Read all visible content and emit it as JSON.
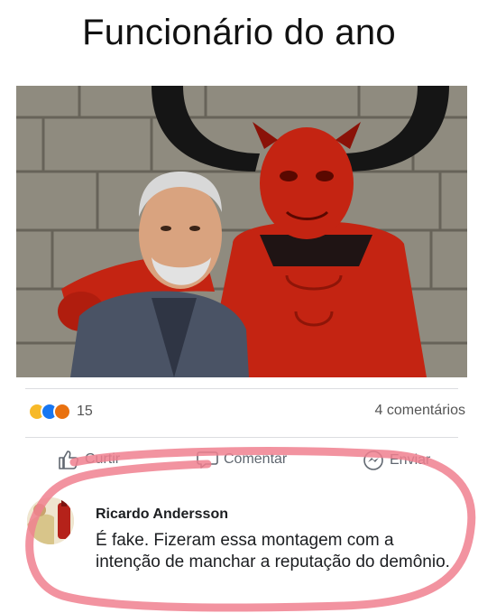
{
  "title": "Funcionário do ano",
  "post": {
    "reactions_count": "15",
    "comments_label": "4 comentários",
    "reaction_icons": [
      "haha-icon",
      "like-icon",
      "angry-icon"
    ]
  },
  "actions": {
    "like_label": "Curtir",
    "comment_label": "Comentar",
    "share_label": "Enviar"
  },
  "comment": {
    "author": "Ricardo Andersson",
    "text": "É fake. Fizeram essa montagem com a intenção de manchar a reputação do demônio."
  },
  "colors": {
    "highlight": "#f0808f",
    "action_text": "#606770",
    "like_blue": "#1877f2"
  }
}
